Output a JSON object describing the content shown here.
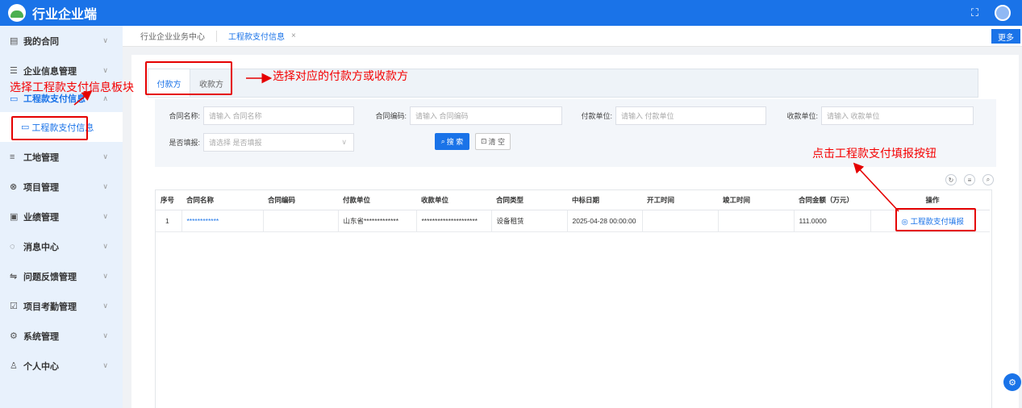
{
  "app": {
    "title": "行业企业端"
  },
  "sidebar": {
    "items": [
      {
        "icon": "contract-icon",
        "glyph": "▤",
        "label": "我的合同"
      },
      {
        "icon": "enterprise-icon",
        "glyph": "☰",
        "label": "企业信息管理"
      },
      {
        "icon": "payment-icon",
        "glyph": "▭",
        "label": "工程款支付信息"
      },
      {
        "icon": "site-icon",
        "glyph": "≡",
        "label": "工地管理"
      },
      {
        "icon": "project-icon",
        "glyph": "⊗",
        "label": "项目管理"
      },
      {
        "icon": "performance-icon",
        "glyph": "▣",
        "label": "业绩管理"
      },
      {
        "icon": "message-icon",
        "glyph": "◌",
        "label": "消息中心"
      },
      {
        "icon": "feedback-icon",
        "glyph": "⇋",
        "label": "问题反馈管理"
      },
      {
        "icon": "attendance-icon",
        "glyph": "☑",
        "label": "项目考勤管理"
      },
      {
        "icon": "system-icon",
        "glyph": "⚙",
        "label": "系统管理"
      },
      {
        "icon": "person-icon",
        "glyph": "♙",
        "label": "个人中心"
      }
    ],
    "sub_item": "工程款支付信息"
  },
  "tabs": {
    "home": "行业企业业务中心",
    "active": "工程款支付信息",
    "more": "更多"
  },
  "inner_tabs": [
    "付款方",
    "收款方"
  ],
  "search": {
    "contract_name_label": "合同名称:",
    "contract_name_placeholder": "请输入 合同名称",
    "contract_code_label": "合同编码:",
    "contract_code_placeholder": "请输入 合同编码",
    "payer_label": "付款单位:",
    "payer_placeholder": "请输入 付款单位",
    "payee_label": "收款单位:",
    "payee_placeholder": "请输入 收款单位",
    "filled_label": "是否填报:",
    "filled_placeholder": "请选择 是否填报",
    "search_button": "搜 索",
    "clear_button": "清 空"
  },
  "table": {
    "headers": [
      "序号",
      "合同名称",
      "合同编码",
      "付款单位",
      "收款单位",
      "合同类型",
      "中标日期",
      "开工时间",
      "竣工时间",
      "合同金额（万元）",
      "操作"
    ],
    "rows": [
      {
        "index": "1",
        "name": "************",
        "code": "",
        "payer": "山东省*************",
        "payee": "*********************",
        "type": "设备租赁",
        "bid_date": "2025-04-28 00:00:00",
        "start": "",
        "end": "",
        "amount": "111.0000",
        "action": "工程款支付填报"
      }
    ]
  },
  "annotations": {
    "select_module": "选择工程款支付信息板块",
    "select_party": "选择对应的付款方或收款方",
    "click_button": "点击工程款支付填报按钮"
  },
  "colors": {
    "primary": "#1a73e8",
    "annotation": "#f40000",
    "sidebar_bg": "#e8f1fc"
  }
}
